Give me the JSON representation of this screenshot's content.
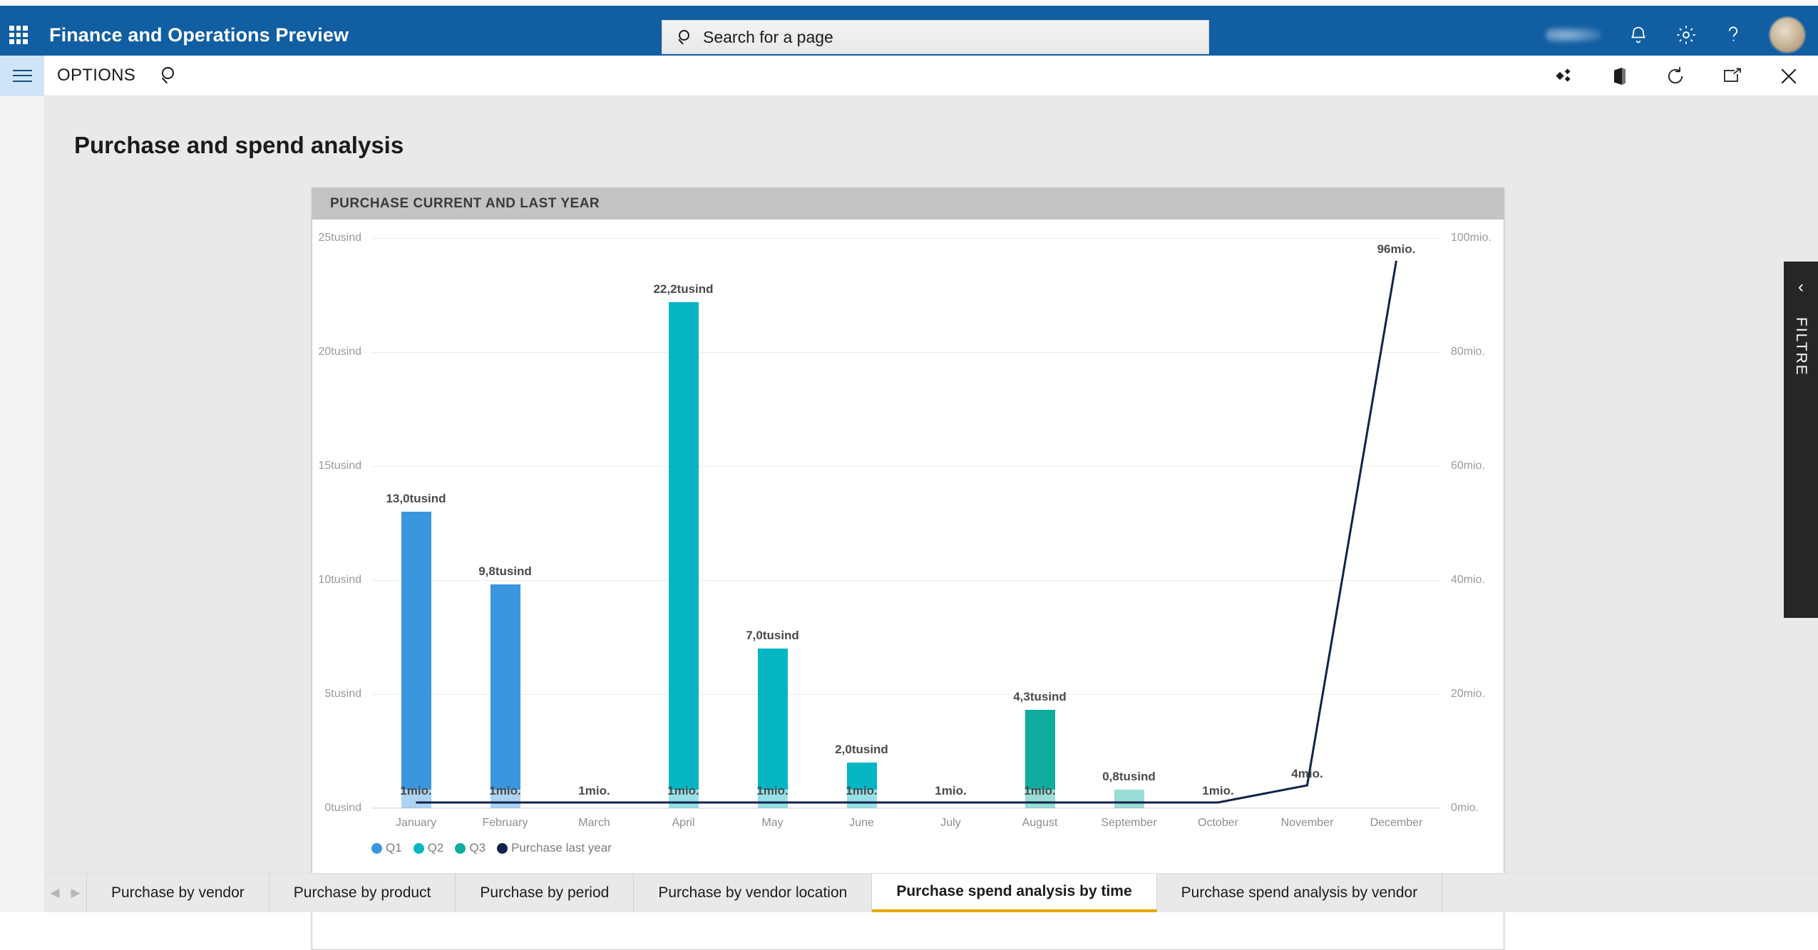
{
  "topbar": {
    "app_title": "Finance and Operations Preview",
    "waffle_icon": "app-launcher-icon",
    "search_placeholder": "Search for a page",
    "search_value": "",
    "search_icon": "search-icon",
    "notifications_icon": "bell-icon",
    "settings_icon": "gear-icon",
    "help_icon": "question-mark-icon",
    "avatar_icon": "user-avatar",
    "brand_color": "#115ea3"
  },
  "optionsbar": {
    "menu_icon": "hamburger-icon",
    "options_label": "OPTIONS",
    "search_icon": "search-icon",
    "personalize_icon": "personalize-diamond-icon",
    "office_icon": "office-app-icon",
    "refresh_icon": "refresh-icon",
    "popout_icon": "open-in-new-window-icon",
    "close_icon": "close-icon"
  },
  "page": {
    "title": "Purchase and spend analysis"
  },
  "card": {
    "header": "PURCHASE CURRENT AND LAST YEAR"
  },
  "filter_panel": {
    "collapse_icon": "chevron-left-icon",
    "label": "FILTRE"
  },
  "tabs": {
    "prev_icon": "chevron-left-icon",
    "next_icon": "chevron-right-icon",
    "items": [
      {
        "label": "Purchase by vendor",
        "active": false
      },
      {
        "label": "Purchase by product",
        "active": false
      },
      {
        "label": "Purchase by period",
        "active": false
      },
      {
        "label": "Purchase by vendor location",
        "active": false
      },
      {
        "label": "Purchase spend analysis by time",
        "active": true
      },
      {
        "label": "Purchase spend analysis by vendor",
        "active": false
      }
    ],
    "active_underline_color": "#e8a600"
  },
  "chart_data": {
    "type": "bar",
    "title": "PURCHASE CURRENT AND LAST YEAR",
    "xlabel": "",
    "ylabel": "",
    "categories": [
      "January",
      "February",
      "March",
      "April",
      "May",
      "June",
      "July",
      "August",
      "September",
      "October",
      "November",
      "December"
    ],
    "left_axis": {
      "ticks": [
        "0tusind",
        "5tusind",
        "10tusind",
        "15tusind",
        "20tusind",
        "25tusind"
      ],
      "tick_values": [
        0,
        5000,
        10000,
        15000,
        20000,
        25000
      ],
      "ylim": [
        0,
        25000
      ],
      "unit": "tusind"
    },
    "right_axis": {
      "ticks": [
        "0mio.",
        "20mio.",
        "40mio.",
        "60mio.",
        "80mio.",
        "100mio."
      ],
      "tick_values": [
        0,
        20,
        40,
        60,
        80,
        100
      ],
      "ylim": [
        0,
        100
      ],
      "unit": "mio."
    },
    "grid": true,
    "legend_position": "bottom-left",
    "series": [
      {
        "name": "Q1",
        "type": "bar",
        "color": "#3a96dd",
        "axis": "left",
        "values": [
          13000,
          9800,
          0,
          null,
          null,
          null,
          null,
          null,
          null,
          null,
          null,
          null
        ],
        "labels": [
          "13,0tusind",
          "9,8tusind",
          "",
          "",
          "",
          "",
          "",
          "",
          "",
          "",
          "",
          ""
        ]
      },
      {
        "name": "Q2",
        "type": "bar",
        "color": "#06b6c4",
        "axis": "left",
        "values": [
          null,
          null,
          null,
          22200,
          7000,
          2000,
          0,
          null,
          null,
          null,
          null,
          null
        ],
        "labels": [
          "",
          "",
          "",
          "22,2tusind",
          "7,0tusind",
          "2,0tusind",
          "",
          "",
          "",
          "",
          "",
          ""
        ]
      },
      {
        "name": "Q3",
        "type": "bar",
        "color": "#0eab9e",
        "axis": "left",
        "values": [
          null,
          null,
          null,
          null,
          null,
          null,
          null,
          4300,
          800,
          0,
          null,
          null
        ],
        "labels": [
          "",
          "",
          "",
          "",
          "",
          "",
          "",
          "4,3tusind",
          "0,8tusind",
          "",
          "",
          ""
        ]
      },
      {
        "name": "Purchase last year",
        "type": "line",
        "color": "#10234b",
        "axis": "right",
        "values": [
          1,
          1,
          1,
          1,
          1,
          1,
          1,
          1,
          1,
          1,
          4,
          96
        ],
        "labels": [
          "1mio.",
          "1mio.",
          "1mio.",
          "1mio.",
          "1mio.",
          "1mio.",
          "1mio.",
          "1mio.",
          "",
          "1mio.",
          "4mio.",
          "96mio."
        ]
      }
    ],
    "legend": [
      {
        "label": "Q1",
        "color": "#3a96dd"
      },
      {
        "label": "Q2",
        "color": "#06b6c4"
      },
      {
        "label": "Q3",
        "color": "#0eab9e"
      },
      {
        "label": "Purchase last year",
        "color": "#10234b"
      }
    ]
  }
}
